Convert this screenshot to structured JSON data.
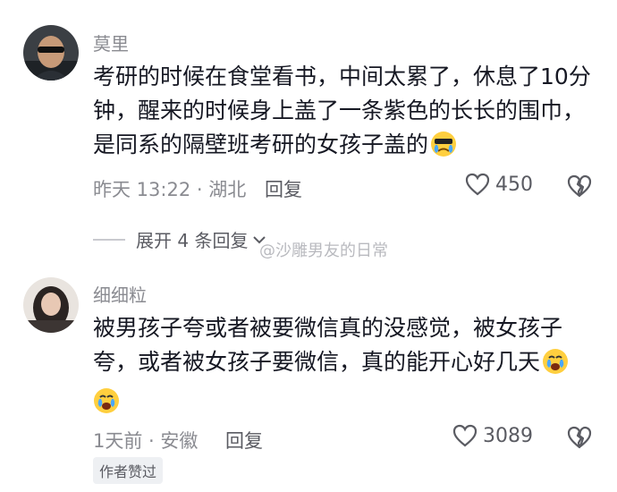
{
  "comments": [
    {
      "username": "莫里",
      "lines": [
        "考研的时候在食堂看书，中间太累了，休息了10分",
        "钟，醒来的时候身上盖了一条紫色的长长的围巾，",
        "是同系的隔壁班考研的女孩子盖的"
      ],
      "emoji": "crying-face-emoji",
      "time_location": "昨天 13:22 · 湖北",
      "reply_label": "回复",
      "likes": "450"
    },
    {
      "username": "细细粒",
      "lines": [
        "被男孩子夸或者被要微信真的没感觉，被女孩子",
        "夸，或者被女孩子要微信，真的能开心好几天"
      ],
      "emoji": "crying-face-emoji",
      "time_location": "1天前 · 安徽",
      "reply_label": "回复",
      "likes": "3089",
      "author_badge": "作者赞过"
    }
  ],
  "expand_replies": "展开 4 条回复",
  "watermark": "@沙雕男友的日常",
  "colors": {
    "text": "#161823",
    "meta": "#8a8b91",
    "emoji_face": "#ffcf3f",
    "tear": "#4aa8ff"
  }
}
